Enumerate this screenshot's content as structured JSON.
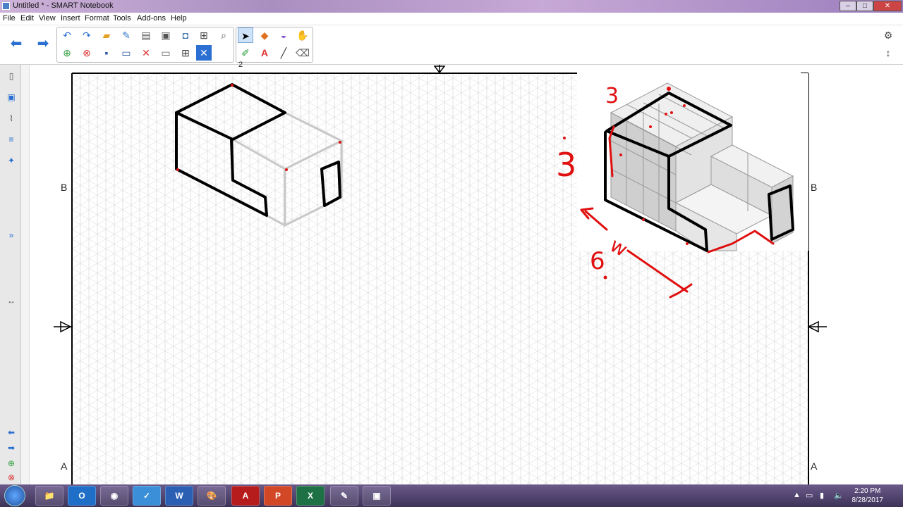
{
  "window": {
    "title": "Untitled * - SMART Notebook",
    "minimize": "–",
    "maximize": "□",
    "close": "✕"
  },
  "menu": [
    "File",
    "Edit",
    "View",
    "Insert",
    "Format",
    "Tools",
    "Add-ons",
    "Help"
  ],
  "toolbar": {
    "nav_icons": [
      "back-arrow-icon",
      "forward-arrow-icon"
    ],
    "row1_icons": [
      "undo-icon",
      "redo-icon",
      "open-folder-icon",
      "clear-ink-icon",
      "paste-icon",
      "screenshot-icon",
      "document-camera-icon",
      "table-icon",
      "magnifier-icon"
    ],
    "row2_icons": [
      "add-page-icon",
      "delete-page-icon",
      "save-icon",
      "screen-shade-icon",
      "delete-icon",
      "display-screen-icon",
      "table-insert-icon",
      "close-x-icon"
    ],
    "tools_row1": [
      "select-icon",
      "shapes-icon",
      "eraser-brush-icon",
      "magic-pen-icon"
    ],
    "tools_row2": [
      "pens-icon",
      "text-icon",
      "line-icon",
      "eraser-icon"
    ]
  },
  "canvas": {
    "labels": {
      "b_left": "B",
      "b_right": "B",
      "a_left": "A",
      "a_right": "A",
      "top_num": "2"
    },
    "annotations": {
      "dim_top": "3",
      "dim_left": "3",
      "dim_bottom": "6",
      "dim_w": "w"
    }
  },
  "taskbar": {
    "apps": [
      {
        "name": "file-explorer",
        "label": "📁"
      },
      {
        "name": "outlook",
        "label": "O"
      },
      {
        "name": "chrome",
        "label": "◉"
      },
      {
        "name": "notes",
        "label": "✓"
      },
      {
        "name": "word",
        "label": "W"
      },
      {
        "name": "paint",
        "label": "🎨"
      },
      {
        "name": "acrobat",
        "label": "A"
      },
      {
        "name": "powerpoint",
        "label": "P"
      },
      {
        "name": "excel",
        "label": "X"
      },
      {
        "name": "smart-tools",
        "label": "✎"
      },
      {
        "name": "notebook",
        "label": "▣"
      }
    ],
    "time": "2:20 PM",
    "date": "8/28/2017"
  },
  "colors": {
    "accent_red": "#e01010",
    "stroke": "#000000",
    "ghost": "#c8c8c8"
  }
}
